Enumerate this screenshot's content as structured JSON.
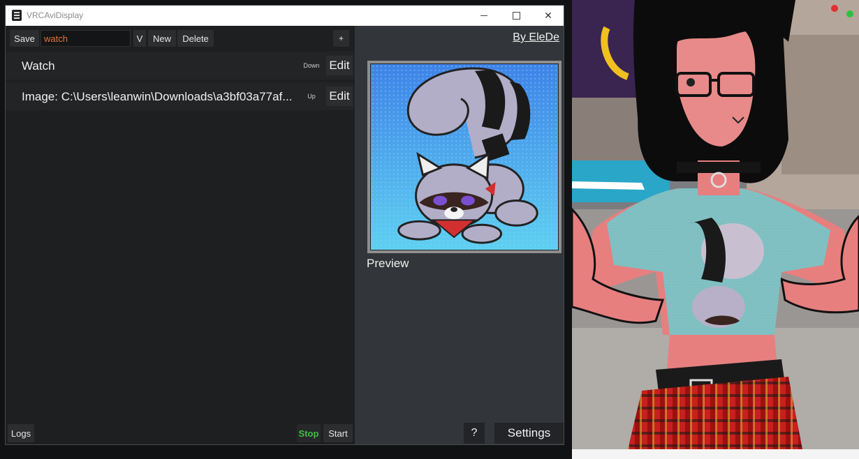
{
  "window": {
    "title": "VRCAviDisplay",
    "controls": {
      "minimize": "minimize",
      "maximize": "maximize",
      "close": "close"
    }
  },
  "toolbar": {
    "save_label": "Save",
    "name_value": "watch",
    "v_label": "V",
    "new_label": "New",
    "delete_label": "Delete",
    "add_label": "+"
  },
  "list": {
    "items": [
      {
        "label": "Watch",
        "move_label": "Down",
        "edit_label": "Edit"
      },
      {
        "label": "Image: C:\\Users\\leanwin\\Downloads\\a3bf03a77af...",
        "move_label": "Up",
        "edit_label": "Edit"
      }
    ]
  },
  "footer": {
    "logs_label": "Logs",
    "stop_label": "Stop",
    "start_label": "Start"
  },
  "right_panel": {
    "credit": "By EleDe",
    "preview_label": "Preview",
    "help_label": "?",
    "settings_label": "Settings"
  },
  "colors": {
    "stop_active": "#3fbf3f",
    "name_input_text": "#e0763a",
    "left_bg": "#1e1f20",
    "right_bg": "#323539"
  }
}
